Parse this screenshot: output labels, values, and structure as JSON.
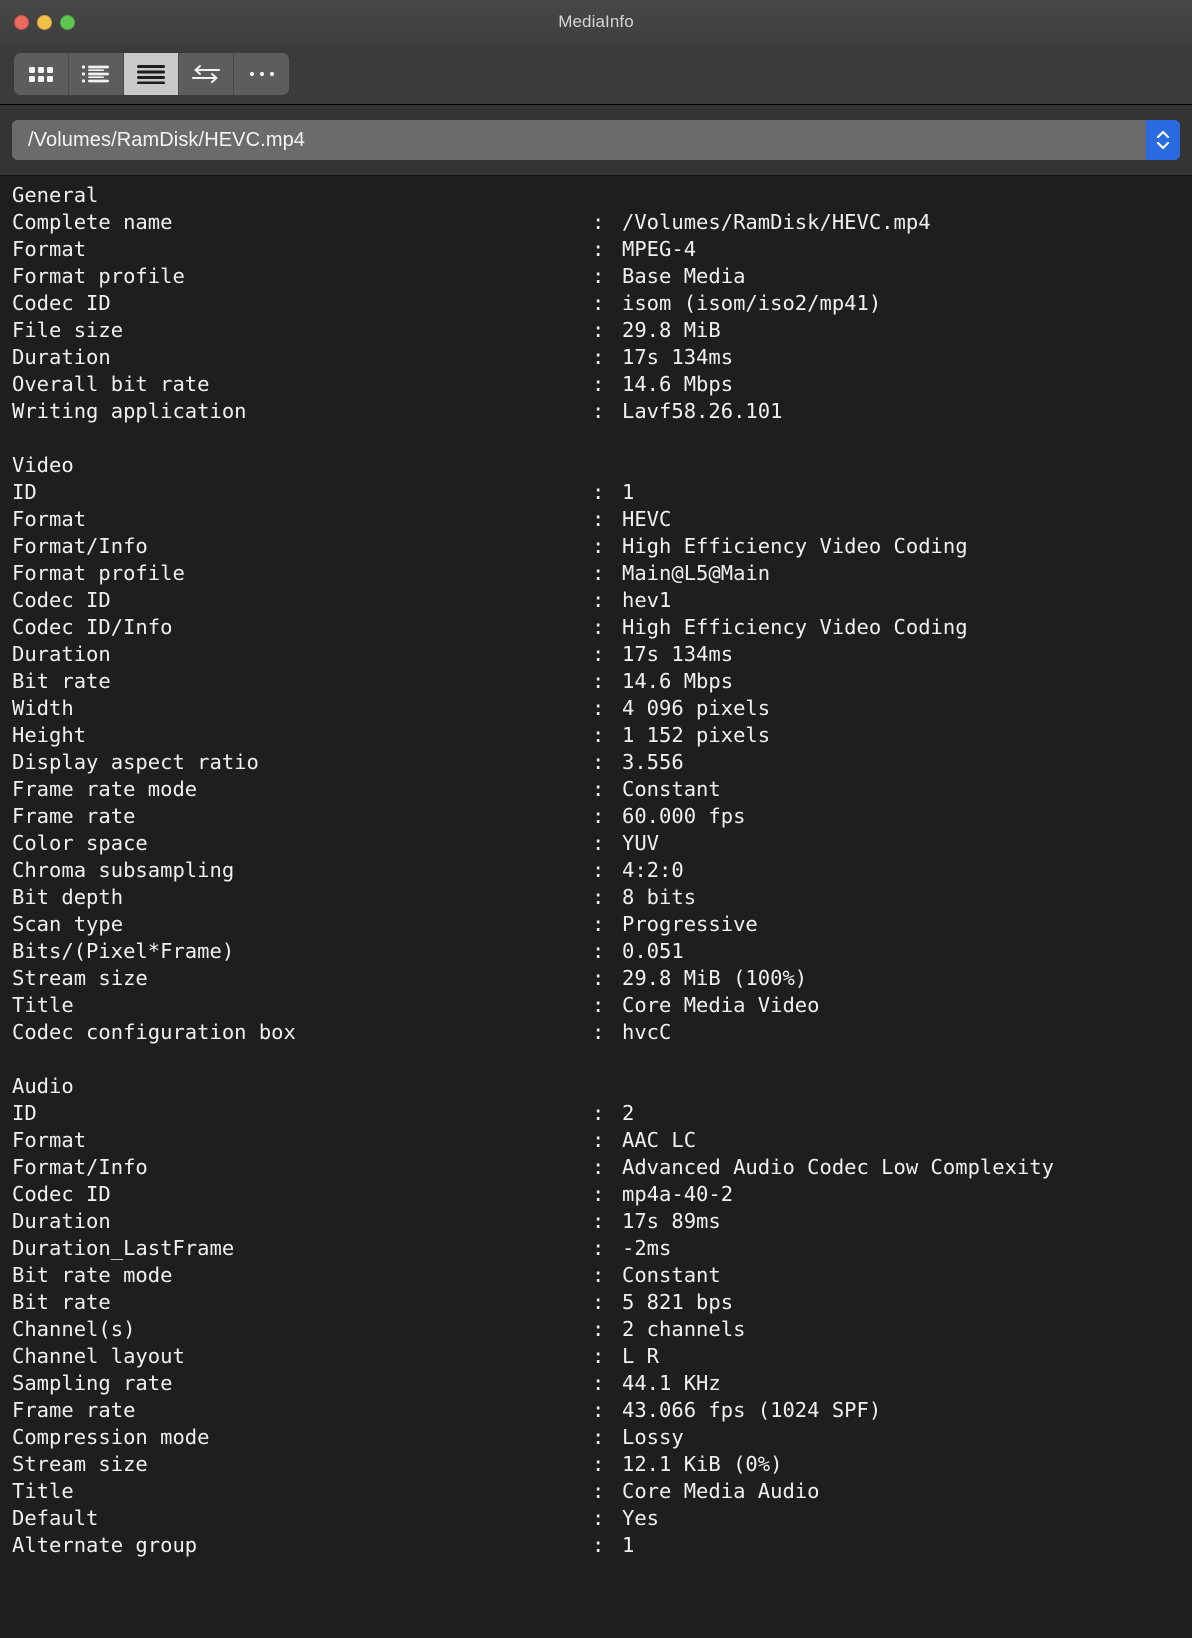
{
  "window": {
    "title": "MediaInfo",
    "traffic_lights": [
      "close",
      "minimize",
      "maximize"
    ]
  },
  "toolbar": {
    "items": [
      {
        "name": "grid-view",
        "icon": "grid-icon",
        "active": false
      },
      {
        "name": "tree-view",
        "icon": "tree-list-icon",
        "active": false
      },
      {
        "name": "text-view",
        "icon": "list-lines-icon",
        "active": true
      },
      {
        "name": "compare-view",
        "icon": "swap-arrows-icon",
        "active": false
      },
      {
        "name": "more-options",
        "icon": "ellipsis-icon",
        "active": false
      }
    ]
  },
  "pathbar": {
    "value": "/Volumes/RamDisk/HEVC.mp4",
    "placeholder": "/Volumes/RamDisk/HEVC.mp4",
    "stepper_icon": "chevron-up-down-icon",
    "accent_color": "#2a6ae0"
  },
  "report": {
    "separator": ":",
    "sections": [
      {
        "name": "General",
        "rows": [
          {
            "key": "Complete name",
            "value": "/Volumes/RamDisk/HEVC.mp4"
          },
          {
            "key": "Format",
            "value": "MPEG-4"
          },
          {
            "key": "Format profile",
            "value": "Base Media"
          },
          {
            "key": "Codec ID",
            "value": "isom (isom/iso2/mp41)"
          },
          {
            "key": "File size",
            "value": "29.8 MiB"
          },
          {
            "key": "Duration",
            "value": "17s 134ms"
          },
          {
            "key": "Overall bit rate",
            "value": "14.6 Mbps"
          },
          {
            "key": "Writing application",
            "value": "Lavf58.26.101"
          }
        ]
      },
      {
        "name": "Video",
        "rows": [
          {
            "key": "ID",
            "value": "1"
          },
          {
            "key": "Format",
            "value": "HEVC"
          },
          {
            "key": "Format/Info",
            "value": "High Efficiency Video Coding"
          },
          {
            "key": "Format profile",
            "value": "Main@L5@Main"
          },
          {
            "key": "Codec ID",
            "value": "hev1"
          },
          {
            "key": "Codec ID/Info",
            "value": "High Efficiency Video Coding"
          },
          {
            "key": "Duration",
            "value": "17s 134ms"
          },
          {
            "key": "Bit rate",
            "value": "14.6 Mbps"
          },
          {
            "key": "Width",
            "value": "4 096 pixels"
          },
          {
            "key": "Height",
            "value": "1 152 pixels"
          },
          {
            "key": "Display aspect ratio",
            "value": "3.556"
          },
          {
            "key": "Frame rate mode",
            "value": "Constant"
          },
          {
            "key": "Frame rate",
            "value": "60.000 fps"
          },
          {
            "key": "Color space",
            "value": "YUV"
          },
          {
            "key": "Chroma subsampling",
            "value": "4:2:0"
          },
          {
            "key": "Bit depth",
            "value": "8 bits"
          },
          {
            "key": "Scan type",
            "value": "Progressive"
          },
          {
            "key": "Bits/(Pixel*Frame)",
            "value": "0.051"
          },
          {
            "key": "Stream size",
            "value": "29.8 MiB (100%)"
          },
          {
            "key": "Title",
            "value": "Core Media Video"
          },
          {
            "key": "Codec configuration box",
            "value": "hvcC"
          }
        ]
      },
      {
        "name": "Audio",
        "rows": [
          {
            "key": "ID",
            "value": "2"
          },
          {
            "key": "Format",
            "value": "AAC LC"
          },
          {
            "key": "Format/Info",
            "value": "Advanced Audio Codec Low Complexity"
          },
          {
            "key": "Codec ID",
            "value": "mp4a-40-2"
          },
          {
            "key": "Duration",
            "value": "17s 89ms"
          },
          {
            "key": "Duration_LastFrame",
            "value": "-2ms"
          },
          {
            "key": "Bit rate mode",
            "value": "Constant"
          },
          {
            "key": "Bit rate",
            "value": "5 821 bps"
          },
          {
            "key": "Channel(s)",
            "value": "2 channels"
          },
          {
            "key": "Channel layout",
            "value": "L R"
          },
          {
            "key": "Sampling rate",
            "value": "44.1 KHz"
          },
          {
            "key": "Frame rate",
            "value": "43.066 fps (1024 SPF)"
          },
          {
            "key": "Compression mode",
            "value": "Lossy"
          },
          {
            "key": "Stream size",
            "value": "12.1 KiB (0%)"
          },
          {
            "key": "Title",
            "value": "Core Media Audio"
          },
          {
            "key": "Default",
            "value": "Yes"
          },
          {
            "key": "Alternate group",
            "value": "1"
          }
        ]
      }
    ]
  }
}
